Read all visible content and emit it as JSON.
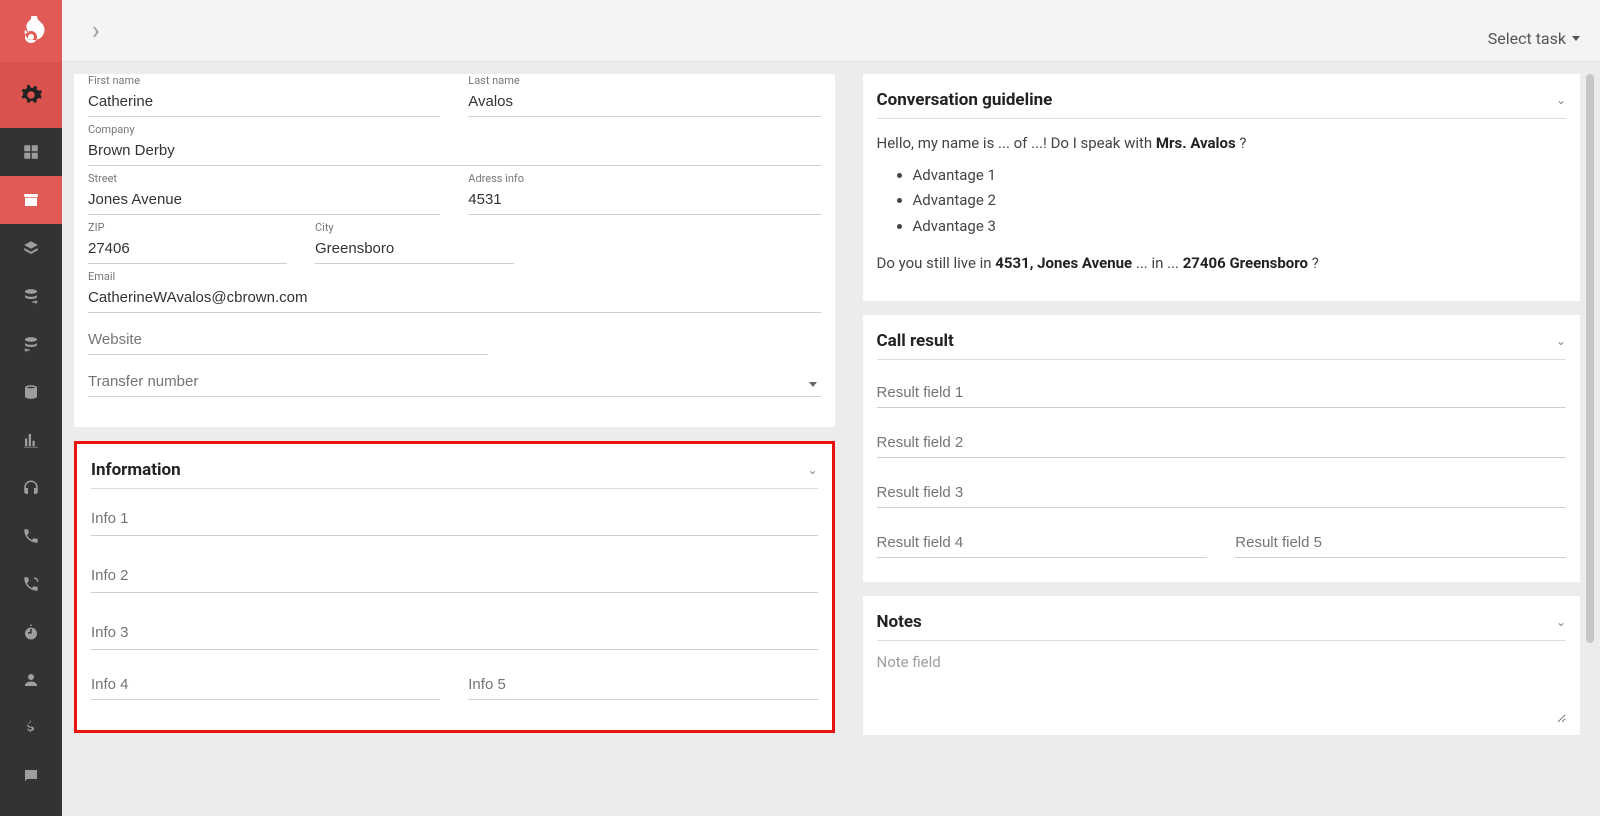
{
  "topbar": {
    "select_task": "Select task"
  },
  "contact": {
    "labels": {
      "first_name": "First name",
      "last_name": "Last name",
      "company": "Company",
      "street": "Street",
      "address_info": "Adress info",
      "zip": "ZIP",
      "city": "City",
      "email": "Email"
    },
    "first_name": "Catherine",
    "last_name": "Avalos",
    "company": "Brown Derby",
    "street": "Jones Avenue",
    "address_info": "4531",
    "zip": "27406",
    "city": "Greensboro",
    "email": "CatherineWAvalos@cbrown.com",
    "website_placeholder": "Website",
    "transfer_placeholder": "Transfer number"
  },
  "information": {
    "title": "Information",
    "placeholders": [
      "Info 1",
      "Info 2",
      "Info 3",
      "Info 4",
      "Info 5"
    ]
  },
  "guideline": {
    "title": "Conversation guideline",
    "greeting_pre": "Hello, my name is ... of ...! Do I speak with ",
    "greeting_name": "Mrs. Avalos",
    "greeting_post": " ?",
    "bullets": [
      "Advantage 1",
      "Advantage 2",
      "Advantage 3"
    ],
    "confirm_pre": "Do you still live in ",
    "confirm_addr": "4531, Jones Avenue",
    "confirm_mid": " ... in ... ",
    "confirm_city": "27406 Greensboro",
    "confirm_post": " ?"
  },
  "call_result": {
    "title": "Call result",
    "placeholders": [
      "Result field 1",
      "Result field 2",
      "Result field 3",
      "Result field 4",
      "Result field 5"
    ]
  },
  "notes": {
    "title": "Notes",
    "placeholder": "Note field"
  }
}
